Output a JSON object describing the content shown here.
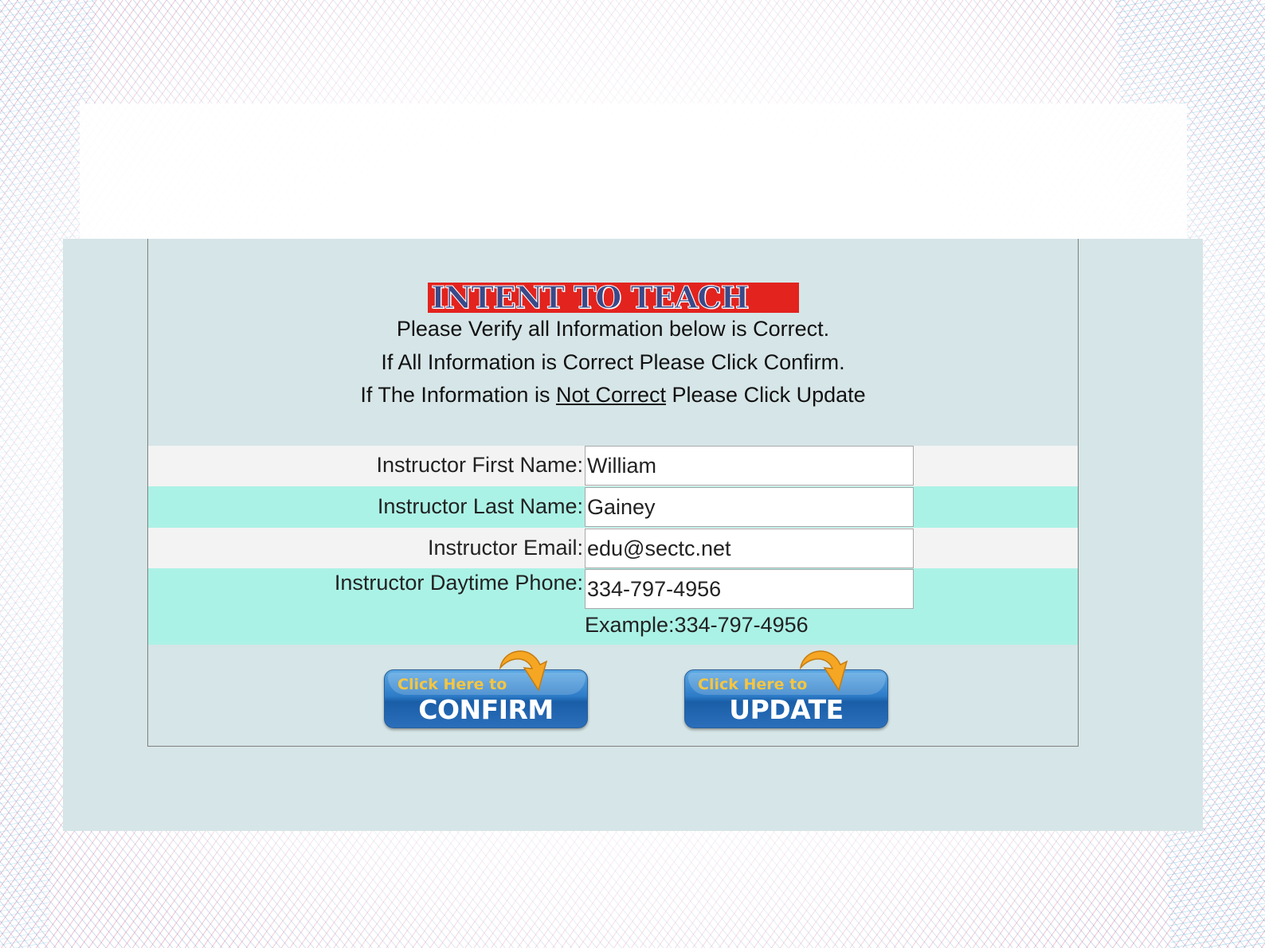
{
  "page": {
    "title": "INTENT TO TEACH",
    "instructions": {
      "line1": "Please Verify all Information below is Correct.",
      "line2": "If All Information is Correct Please Click Confirm.",
      "line3_prefix": "If The Information is ",
      "line3_underlined": "Not Correct",
      "line3_suffix": " Please Click Update"
    }
  },
  "form": {
    "first_name": {
      "label": "Instructor First Name:",
      "value": "William"
    },
    "last_name": {
      "label": "Instructor Last Name:",
      "value": "Gainey"
    },
    "email": {
      "label": "Instructor Email:",
      "value": "edu@sectc.net"
    },
    "phone": {
      "label": "Instructor Daytime Phone:",
      "value": "334-797-4956",
      "example": "Example:334-797-4956"
    }
  },
  "buttons": {
    "confirm": {
      "small_text": "Click Here to",
      "big_text": "CONFIRM"
    },
    "update": {
      "small_text": "Click Here to",
      "big_text": "UPDATE"
    }
  },
  "colors": {
    "panel_bg": "#d6e5e7",
    "row_light": "#f3f3f3",
    "row_teal": "#abf2e6",
    "title_banner": "#e3231e",
    "button_blue": "#2d7cc8",
    "button_accent": "#f5c542"
  }
}
